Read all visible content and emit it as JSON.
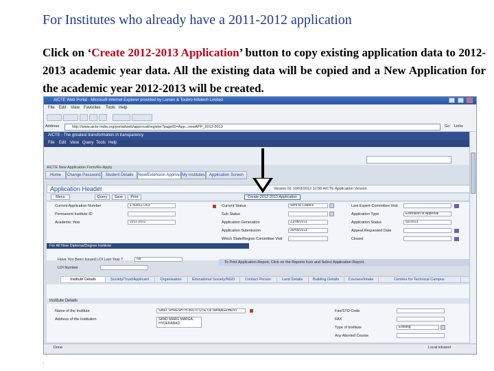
{
  "slide": {
    "title": "For Institutes who already have a 2011-2012  application",
    "body_pre": "Click on ‘",
    "body_highlight": "Create 2012-2013 Application",
    "body_post": "’ button to copy existing application data to 2012-2013 academic year data. All the existing data will be copied and a New Application for the academic year 2012-2013 will be created.",
    "bullet": "."
  },
  "browser": {
    "title": "AICTE Web Portal - Microsoft Internet Explorer provided by Larsen & Toubro Infotech Limited",
    "menu": [
      "File",
      "Edit",
      "View",
      "Favorites",
      "Tools",
      "Help"
    ],
    "address_label": "Address",
    "address_value": "http://www.aicte-india.org/portal/web/approval/register?pageID=App...newAPP_2012-2013",
    "go_label": "Go",
    "links_label": "Links",
    "status_left": "Done",
    "status_right": "Local intranet"
  },
  "portal": {
    "header": "AICTE - The greatest transformation in transparency",
    "menu": [
      "File",
      "Edit",
      "View",
      "Query",
      "Tools",
      "Help"
    ],
    "breadcrumb": "AICTE New Application Form/Re-Apply",
    "tabs": [
      "Home",
      "Change Password",
      "Student Details",
      "New/Extension Approval",
      "My Institutes",
      "Application Screen"
    ],
    "app_header_title": "Application Header",
    "version_info": "Version 01 10/03/2012 12:56 AICTE Application Version",
    "toolbar": [
      "Menu",
      "Query",
      "Save",
      "Print",
      "Create 2012-2013 Application"
    ],
    "form_left": [
      {
        "label": "Current Application Number",
        "value": "1-504527263"
      },
      {
        "label": "Permanent Institute ID",
        "value": ""
      },
      {
        "label": "Academic Year",
        "value": "2011-2012"
      }
    ],
    "form_mid": [
      {
        "label": "Current Status",
        "value": "Sent to Council"
      },
      {
        "label": "Sub Status",
        "value": ""
      },
      {
        "label": "Application Generation",
        "value": "21/08/2011"
      },
      {
        "label": "Application Submission",
        "value": "30/09/2011"
      },
      {
        "label": "Which State/Region Committee Visit",
        "value": ""
      }
    ],
    "form_right": [
      {
        "label": "Last Expert Committee Visit",
        "value": ""
      },
      {
        "label": "Application Type",
        "value": "Extension of Approval"
      },
      {
        "label": "Application Status",
        "value": "02/2013"
      },
      {
        "label": "Appeal Requested Date",
        "value": ""
      },
      {
        "label": "Closed",
        "value": ""
      }
    ],
    "new_app_section": "For All New Diploma/Degree Institute",
    "new_app_question": "Have You Been Issued LOI Last Year ?",
    "new_app_answer": "No",
    "loi_label": "LOI Number",
    "print_note": "To Print Application Report, Click on the Reports Icon and Select Application Report.",
    "subtabs": [
      "Institute Details",
      "Society/Trust/Applicant",
      "Organisation",
      "Educational Society/NGO",
      "Contact Person",
      "Land Details",
      "Building Details",
      "Courses/Intake",
      "Centres for Technical Campus"
    ],
    "institute_section": "Institute Details",
    "inst_left": [
      {
        "label": "Name of the Institute",
        "value": "SANT SHRESHTH INSTITUTE OF MANAGEMENT"
      },
      {
        "label": "Address of the Institution",
        "value": "SAND MARG MARGA, HYDERABAD"
      }
    ],
    "inst_right": [
      {
        "label": "Fax/STD Code",
        "value": ""
      },
      {
        "label": "FAX",
        "value": ""
      },
      {
        "label": "Type of Institute",
        "value": "Existing"
      },
      {
        "label": "Any Aborted Course",
        "value": ""
      }
    ]
  }
}
